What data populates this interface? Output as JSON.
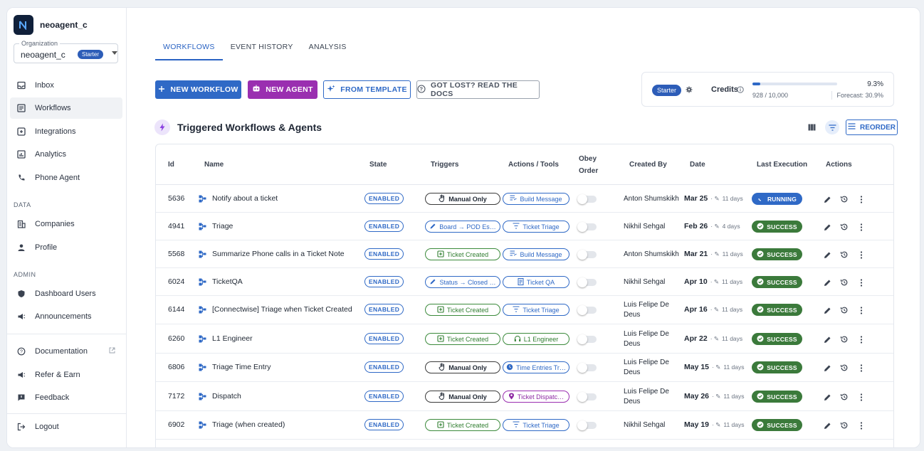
{
  "brand": {
    "name": "neoagent_c"
  },
  "organization": {
    "label": "Organization",
    "name": "neoagent_c",
    "plan": "Starter"
  },
  "sidebar": {
    "main": [
      {
        "label": "Inbox",
        "icon": "inbox-icon"
      },
      {
        "label": "Workflows",
        "icon": "workflow-icon",
        "active": true
      },
      {
        "label": "Integrations",
        "icon": "integrations-icon"
      },
      {
        "label": "Analytics",
        "icon": "analytics-icon"
      },
      {
        "label": "Phone Agent",
        "icon": "phone-icon"
      }
    ],
    "data_label": "DATA",
    "data": [
      {
        "label": "Companies",
        "icon": "building-icon"
      },
      {
        "label": "Profile",
        "icon": "person-icon"
      }
    ],
    "admin_label": "ADMIN",
    "admin": [
      {
        "label": "Dashboard Users",
        "icon": "shield-icon"
      },
      {
        "label": "Announcements",
        "icon": "megaphone-icon"
      }
    ],
    "bottom": [
      {
        "label": "Documentation",
        "icon": "help-icon"
      },
      {
        "label": "Refer & Earn",
        "icon": "megaphone-icon"
      },
      {
        "label": "Feedback",
        "icon": "feedback-icon"
      }
    ],
    "logout": "Logout"
  },
  "tabs": [
    "WORKFLOWS",
    "EVENT HISTORY",
    "ANALYSIS"
  ],
  "toolbar": {
    "new_workflow": "NEW WORKFLOW",
    "new_agent": "NEW AGENT",
    "from_template": "FROM TEMPLATE",
    "docs": "GOT LOST? READ THE DOCS"
  },
  "credits": {
    "plan": "Starter",
    "label": "Credits",
    "percent": "9.3%",
    "fraction": 0.093,
    "used": "928 / 10,000",
    "forecast": "Forecast: 30.9%"
  },
  "section": {
    "title": "Triggered Workflows & Agents",
    "reorder": "REORDER"
  },
  "table": {
    "headers": {
      "id": "Id",
      "name": "Name",
      "state": "State",
      "triggers": "Triggers",
      "actions_tools": "Actions / Tools",
      "obey": "Obey",
      "order": "Order",
      "created_by": "Created By",
      "date": "Date",
      "last_execution": "Last Execution",
      "actions": "Actions"
    },
    "rows": [
      {
        "id": "5636",
        "name": "Notify about a ticket",
        "state": "ENABLED",
        "trigger": "Manual Only",
        "trigger_type": "manual",
        "action": "Build Message",
        "action_type": "blue",
        "created_by": "Anton Shumskikh",
        "date": "Mar 25",
        "ago": "11 days",
        "status": "RUNNING",
        "status_type": "running"
      },
      {
        "id": "4941",
        "name": "Triage",
        "state": "ENABLED",
        "trigger": "Board → POD Es…",
        "trigger_type": "blue",
        "action": "Ticket Triage",
        "action_type": "blue",
        "created_by": "Nikhil Sehgal",
        "date": "Feb 26",
        "ago": "4 days",
        "status": "SUCCESS",
        "status_type": "success"
      },
      {
        "id": "5568",
        "name": "Summarize Phone calls in a Ticket Note",
        "state": "ENABLED",
        "trigger": "Ticket Created",
        "trigger_type": "green",
        "action": "Build Message",
        "action_type": "blue",
        "created_by": "Anton Shumskikh",
        "date": "Mar 21",
        "ago": "11 days",
        "status": "SUCCESS",
        "status_type": "success"
      },
      {
        "id": "6024",
        "name": "TicketQA",
        "state": "ENABLED",
        "trigger": "Status → Closed …",
        "trigger_type": "blue",
        "action": "Ticket QA",
        "action_type": "blue",
        "created_by": "Nikhil Sehgal",
        "date": "Apr 10",
        "ago": "11 days",
        "status": "SUCCESS",
        "status_type": "success"
      },
      {
        "id": "6144",
        "name": "[Connectwise] Triage when Ticket Created",
        "state": "ENABLED",
        "trigger": "Ticket Created",
        "trigger_type": "green",
        "action": "Ticket Triage",
        "action_type": "blue",
        "created_by": "Luis Felipe De Deus",
        "date": "Apr 16",
        "ago": "11 days",
        "status": "SUCCESS",
        "status_type": "success"
      },
      {
        "id": "6260",
        "name": "L1 Engineer",
        "state": "ENABLED",
        "trigger": "Ticket Created",
        "trigger_type": "green",
        "action": "L1 Engineer",
        "action_type": "green",
        "created_by": "Luis Felipe De Deus",
        "date": "Apr 22",
        "ago": "11 days",
        "status": "SUCCESS",
        "status_type": "success"
      },
      {
        "id": "6806",
        "name": "Triage Time Entry",
        "state": "ENABLED",
        "trigger": "Manual Only",
        "trigger_type": "manual",
        "action": "Time Entries Tr…",
        "action_type": "blue",
        "created_by": "Luis Felipe De Deus",
        "date": "May 15",
        "ago": "11 days",
        "status": "SUCCESS",
        "status_type": "success"
      },
      {
        "id": "7172",
        "name": "Dispatch",
        "state": "ENABLED",
        "trigger": "Manual Only",
        "trigger_type": "manual",
        "action": "Ticket Dispatc…",
        "action_type": "purple",
        "created_by": "Luis Felipe De Deus",
        "date": "May 26",
        "ago": "11 days",
        "status": "SUCCESS",
        "status_type": "success"
      },
      {
        "id": "6902",
        "name": "Triage (when created)",
        "state": "ENABLED",
        "trigger": "Ticket Created",
        "trigger_type": "green",
        "action": "Ticket Triage",
        "action_type": "blue",
        "created_by": "Nikhil Sehgal",
        "date": "May 19",
        "ago": "11 days",
        "status": "SUCCESS",
        "status_type": "success"
      }
    ]
  },
  "colors": {
    "primary": "#2f69c6",
    "agent": "#9a2fb0",
    "success": "#3b7a3b"
  }
}
